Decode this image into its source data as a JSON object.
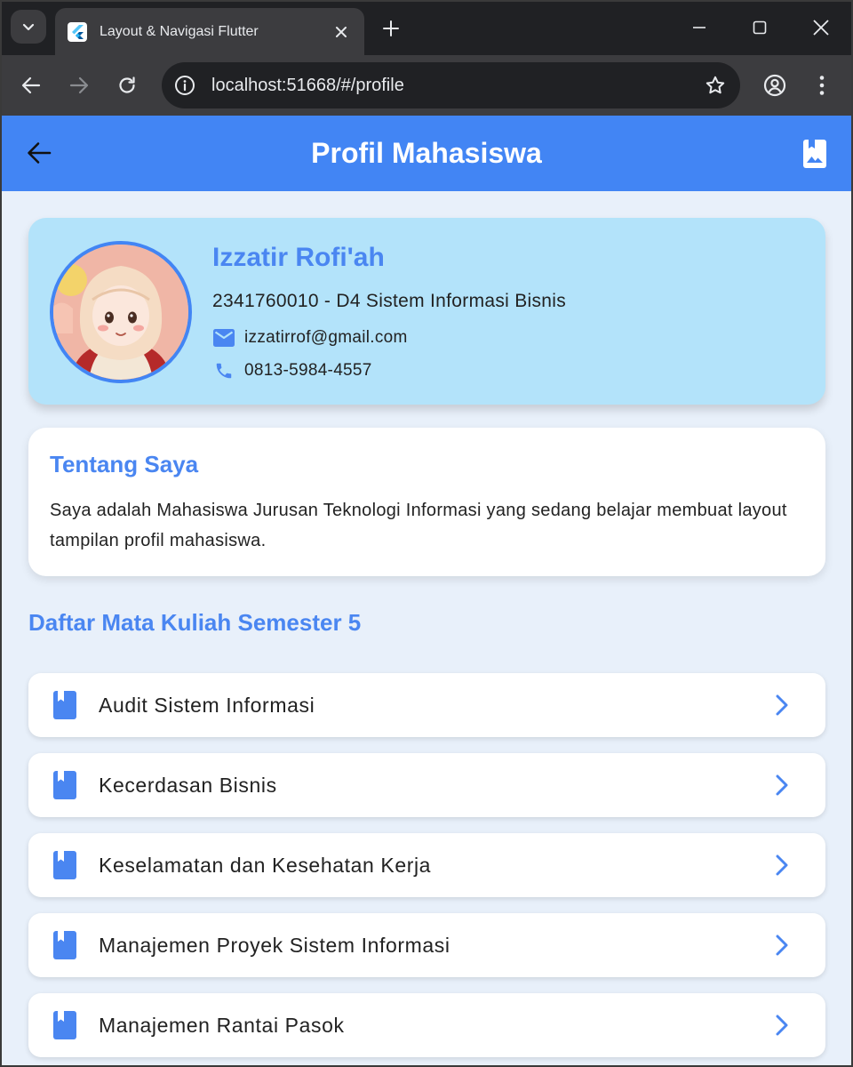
{
  "browser": {
    "tab_title": "Layout & Navigasi Flutter",
    "url": "localhost:51668/#/profile",
    "icons": {
      "tab_search": "chevron-down-icon",
      "favicon": "flutter-logo-icon",
      "close_tab": "close-icon",
      "new_tab": "plus-icon",
      "back": "arrow-left-icon",
      "forward": "arrow-right-icon",
      "reload": "reload-icon",
      "site_info": "info-icon",
      "bookmark": "star-icon",
      "profile": "account-icon",
      "menu": "more-vert-icon"
    }
  },
  "appbar": {
    "title": "Profil Mahasiswa",
    "back_icon": "arrow-left-icon",
    "action_icon": "photo-album-icon",
    "color": "#4285f4"
  },
  "profile": {
    "name": "Izzatir Rofi'ah",
    "nim_program": "2341760010 - D4 Sistem Informasi Bisnis",
    "email": "izzatirrof@gmail.com",
    "phone": "0813-5984-4557",
    "card_color": "#b3e3fa"
  },
  "about": {
    "title": "Tentang Saya",
    "text": "Saya adalah Mahasiswa Jurusan Teknologi Informasi yang sedang belajar membuat layout tampilan profil mahasiswa."
  },
  "courses": {
    "title": "Daftar Mata Kuliah Semester 5",
    "items": [
      {
        "label": "Audit Sistem Informasi"
      },
      {
        "label": "Kecerdasan Bisnis"
      },
      {
        "label": "Keselamatan dan Kesehatan Kerja"
      },
      {
        "label": "Manajemen Proyek Sistem Informasi"
      },
      {
        "label": "Manajemen Rantai Pasok"
      }
    ],
    "item_icon": "book-icon",
    "chevron_icon": "chevron-right-icon"
  },
  "colors": {
    "accent": "#4a86f1",
    "background": "#e8f0fa"
  }
}
